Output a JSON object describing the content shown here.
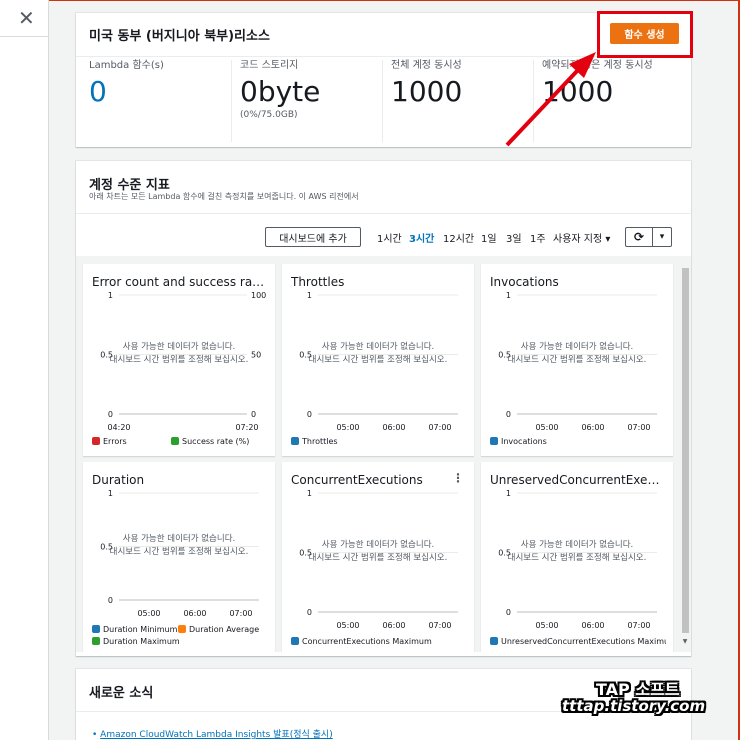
{
  "close_glyph": "✕",
  "account_card": {
    "title": "미국 동부 (버지니아 북부)리소스",
    "create_button": "함수 생성",
    "metrics": [
      {
        "label": "Lambda 함수(s)",
        "value": "0",
        "sub": ""
      },
      {
        "label": "코드 스토리지",
        "value": "0byte",
        "sub": "(0%/75.0GB)"
      },
      {
        "label": "전체 계정 동시성",
        "value": "1000",
        "sub": ""
      },
      {
        "label": "예약되지 않은 계정 동시성",
        "value": "1000",
        "sub": ""
      }
    ]
  },
  "metrics_card": {
    "title": "계정 수준 지표",
    "description": "아래 차트는 모든 Lambda 함수에 걸친 측정치를 보여줍니다. 이 AWS 리전에서",
    "add_dashboard_button": "대시보드에 추가",
    "time_ranges": [
      "1시간",
      "3시간",
      "12시간",
      "1일",
      "3일",
      "1주"
    ],
    "active_time_range": "3시간",
    "custom_range": "사용자 지정 ▾",
    "refresh_icon": "⟳",
    "dropdown_icon": "▾"
  },
  "no_data": {
    "line1": "사용 가능한 데이터가 없습니다.",
    "line2": "대시보드 시간 범위를 조정해 보십시오."
  },
  "colors": {
    "blue": "#1f77b4",
    "orange": "#ff7f0e",
    "green": "#2ca02c",
    "red": "#d62728",
    "accent": "#ec7211",
    "link": "#0073bb"
  },
  "widgets": [
    {
      "title": "Error count and success rate (%)",
      "y_left": [
        "1",
        "0.5",
        "0"
      ],
      "y_right": [
        "100",
        "50",
        "0"
      ],
      "x": [
        "04:20",
        "07:20"
      ],
      "legend": [
        {
          "label": "Errors",
          "color": "#d62728"
        },
        {
          "label": "Success rate (%)",
          "color": "#2ca02c"
        }
      ]
    },
    {
      "title": "Throttles",
      "y_left": [
        "1",
        "0.5",
        "0"
      ],
      "y_right": [],
      "x": [
        "05:00",
        "06:00",
        "07:00"
      ],
      "legend": [
        {
          "label": "Throttles",
          "color": "#1f77b4"
        }
      ]
    },
    {
      "title": "Invocations",
      "y_left": [
        "1",
        "0.5",
        "0"
      ],
      "y_right": [],
      "x": [
        "05:00",
        "06:00",
        "07:00"
      ],
      "legend": [
        {
          "label": "Invocations",
          "color": "#1f77b4"
        }
      ]
    },
    {
      "title": "Duration",
      "y_left": [
        "1",
        "0.5",
        "0"
      ],
      "y_right": [],
      "x": [
        "05:00",
        "06:00",
        "07:00"
      ],
      "legend": [
        {
          "label": "Duration Minimum",
          "color": "#1f77b4"
        },
        {
          "label": "Duration Average",
          "color": "#ff7f0e"
        },
        {
          "label": "Duration Maximum",
          "color": "#2ca02c"
        }
      ]
    },
    {
      "title": "ConcurrentExecutions",
      "y_left": [
        "1",
        "0.5",
        "0"
      ],
      "y_right": [],
      "x": [
        "05:00",
        "06:00",
        "07:00"
      ],
      "legend": [
        {
          "label": "ConcurrentExecutions Maximum",
          "color": "#1f77b4"
        }
      ],
      "menu": "⋮"
    },
    {
      "title": "UnreservedConcurrentExecutions",
      "y_left": [
        "1",
        "0.5",
        "0"
      ],
      "y_right": [],
      "x": [
        "05:00",
        "06:00",
        "07:00"
      ],
      "legend": [
        {
          "label": "UnreservedConcurrentExecutions Maximum",
          "color": "#1f77b4"
        }
      ]
    }
  ],
  "news_card": {
    "title": "새로운 소식",
    "link": "Amazon CloudWatch Lambda Insights 발표(정식 출시)"
  },
  "watermark": {
    "line1": "TAP 소프트",
    "line2": "tttap.tistory.com"
  }
}
